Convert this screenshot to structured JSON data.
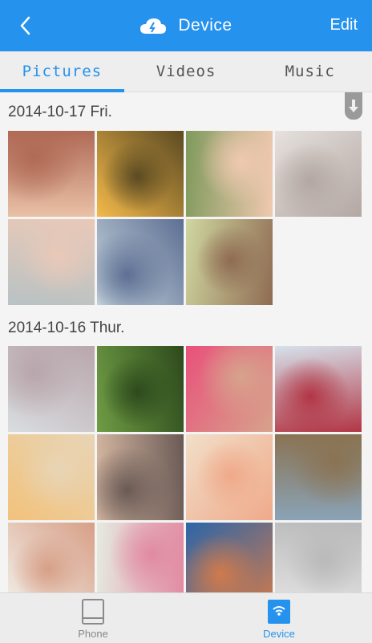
{
  "header": {
    "title": "Device",
    "edit_label": "Edit"
  },
  "tabs": [
    {
      "label": "Pictures",
      "active": true
    },
    {
      "label": "Videos",
      "active": false
    },
    {
      "label": "Music",
      "active": false
    }
  ],
  "sections": [
    {
      "date": "2014-10-17 Fri.",
      "photos": [
        {
          "subject": "woman portrait",
          "palette": [
            "#e9c1a6",
            "#b06a56"
          ]
        },
        {
          "subject": "sunlit forest road",
          "palette": [
            "#f3b94a",
            "#5b4a22"
          ]
        },
        {
          "subject": "child with leaf",
          "palette": [
            "#7f9a5c",
            "#f0c9b0"
          ]
        },
        {
          "subject": "chia pudding jar",
          "palette": [
            "#e6e1de",
            "#b3a7a2"
          ]
        },
        {
          "subject": "pouting child",
          "palette": [
            "#b8c2c4",
            "#e9c9b8"
          ]
        },
        {
          "subject": "girl in denim",
          "palette": [
            "#c9d7dd",
            "#5d6f94"
          ]
        },
        {
          "subject": "woman in meadow",
          "palette": [
            "#cfd7a0",
            "#8f6b52"
          ]
        }
      ]
    },
    {
      "date": "2014-10-16 Thur.",
      "photos": [
        {
          "subject": "misty lotus",
          "palette": [
            "#d9dde0",
            "#b8a6ab"
          ]
        },
        {
          "subject": "green forest light",
          "palette": [
            "#6f9c44",
            "#2d4a1c"
          ]
        },
        {
          "subject": "pink top",
          "palette": [
            "#e9507a",
            "#d7a38c"
          ]
        },
        {
          "subject": "berries jar",
          "palette": [
            "#d6e1ea",
            "#b23645"
          ]
        },
        {
          "subject": "golden lotus haze",
          "palette": [
            "#f2c27c",
            "#e8d4b4"
          ]
        },
        {
          "subject": "woman in shorts",
          "palette": [
            "#d7b9a3",
            "#6a5a55"
          ]
        },
        {
          "subject": "pink flower",
          "palette": [
            "#f1dfc8",
            "#f0a98a"
          ]
        },
        {
          "subject": "desert highway",
          "palette": [
            "#8aa3b7",
            "#8a7353"
          ]
        },
        {
          "subject": "child at window",
          "palette": [
            "#f2efe8",
            "#d79f87"
          ]
        },
        {
          "subject": "pink lotus soft",
          "palette": [
            "#e5ebe0",
            "#e18aa2"
          ]
        },
        {
          "subject": "harbor houses",
          "palette": [
            "#2c65a8",
            "#d07a4c"
          ]
        },
        {
          "subject": "child with bunny",
          "palette": [
            "#e3e3e3",
            "#b9b9b9"
          ]
        }
      ]
    }
  ],
  "bottom_nav": [
    {
      "label": "Phone",
      "icon": "phone-icon",
      "active": false
    },
    {
      "label": "Device",
      "icon": "device-icon",
      "active": true
    }
  ],
  "colors": {
    "accent": "#2592ee"
  }
}
